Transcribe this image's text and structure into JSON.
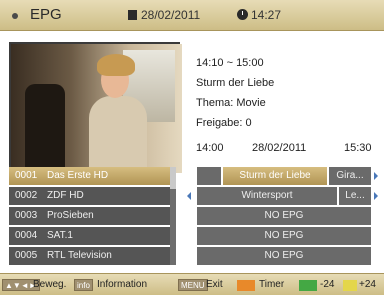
{
  "header": {
    "title": "EPG",
    "date": "28/02/2011",
    "time": "14:27",
    "icons": [
      "bullet-icon",
      "calendar-icon",
      "clock-icon"
    ]
  },
  "program_info": {
    "time_range": "14:10 ~ 15:00",
    "title": "Sturm der Liebe",
    "theme": "Thema: Movie",
    "rating": "Freigabe: 0"
  },
  "timeline": {
    "start": "14:00",
    "date": "28/02/2011",
    "end": "15:30"
  },
  "channels": [
    {
      "num": "0001",
      "name": "Das Erste HD",
      "selected": true
    },
    {
      "num": "0002",
      "name": "ZDF HD",
      "selected": false
    },
    {
      "num": "0003",
      "name": "ProSieben",
      "selected": false
    },
    {
      "num": "0004",
      "name": "SAT.1",
      "selected": false
    },
    {
      "num": "0005",
      "name": "RTL Television",
      "selected": false
    }
  ],
  "grid": {
    "row1": {
      "a": "Sturm der Liebe",
      "b": "Gira..."
    },
    "row2": {
      "a": "Wintersport",
      "b": "Le..."
    },
    "row3": "NO EPG",
    "row4": "NO EPG",
    "row5": "NO EPG"
  },
  "footer": {
    "move_key": "▲▼◄►",
    "move_label": "Beweg.",
    "info_key": "info",
    "info_label": "Information",
    "menu_key": "MENU",
    "menu_label": "Exit",
    "timer_label": "Timer",
    "minus_label": "-24",
    "plus_label": "+24"
  },
  "colors": {
    "accent": "#c8ae6c",
    "timer": "#e8892a",
    "green": "#44a844",
    "yellow": "#e4d64a"
  }
}
